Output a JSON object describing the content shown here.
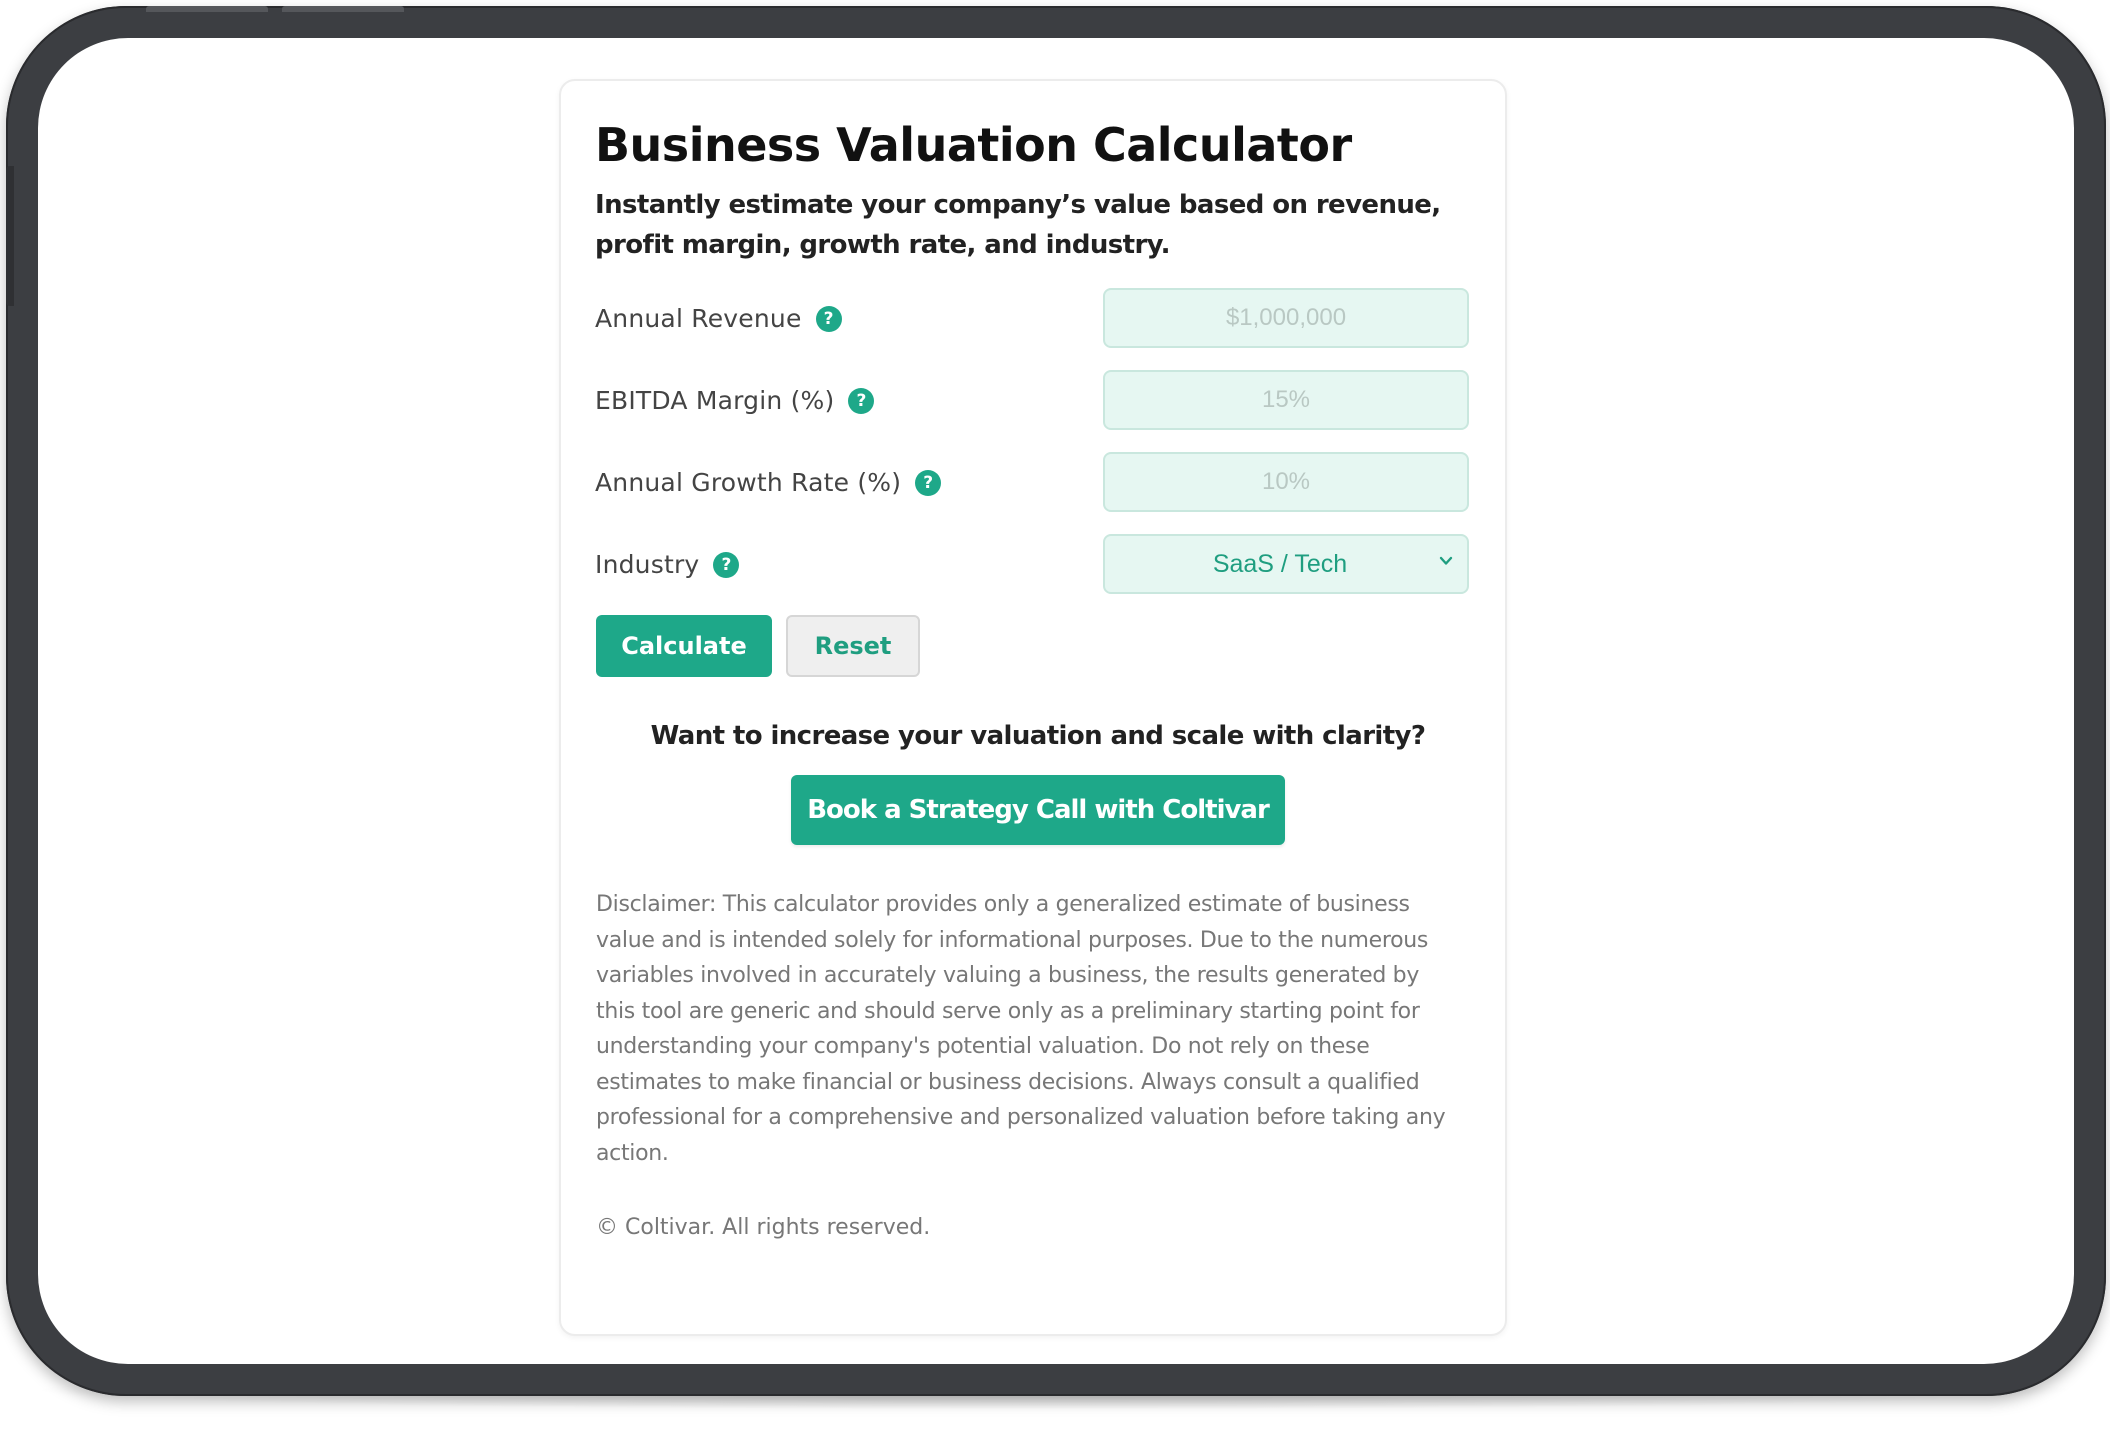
{
  "header": {
    "title": "Business Valuation Calculator",
    "subtitle": "Instantly estimate your company’s value based on revenue, profit margin, growth rate, and industry."
  },
  "form": {
    "revenue": {
      "label": "Annual Revenue",
      "placeholder": "$1,000,000",
      "value": ""
    },
    "ebitda": {
      "label": "EBITDA Margin (%)",
      "placeholder": "15%",
      "value": ""
    },
    "growth": {
      "label": "Annual Growth Rate (%)",
      "placeholder": "10%",
      "value": ""
    },
    "industry": {
      "label": "Industry",
      "selected": "SaaS / Tech"
    },
    "help_glyph": "?"
  },
  "actions": {
    "calculate_label": "Calculate",
    "reset_label": "Reset"
  },
  "cta": {
    "prompt": "Want to increase your valuation and scale with clarity?",
    "button_label": "Book a Strategy Call with Coltivar"
  },
  "disclaimer": "Disclaimer: This calculator provides only a generalized estimate of business value and is intended solely for informational purposes. Due to the numerous variables involved in accurately valuing a business, the results generated by this tool are generic and should serve only as a preliminary starting point for understanding your company's potential valuation. Do not rely on these estimates to make financial or business decisions. Always consult a qualified professional for a comprehensive and personalized valuation before taking any action.",
  "footer": "© Coltivar. All rights reserved.",
  "colors": {
    "accent": "#1ea889",
    "input_background": "#e6f7f2",
    "device_frame": "#3c3e42"
  },
  "icons": {
    "help": "question-circle-icon",
    "dropdown": "chevron-down-icon"
  }
}
